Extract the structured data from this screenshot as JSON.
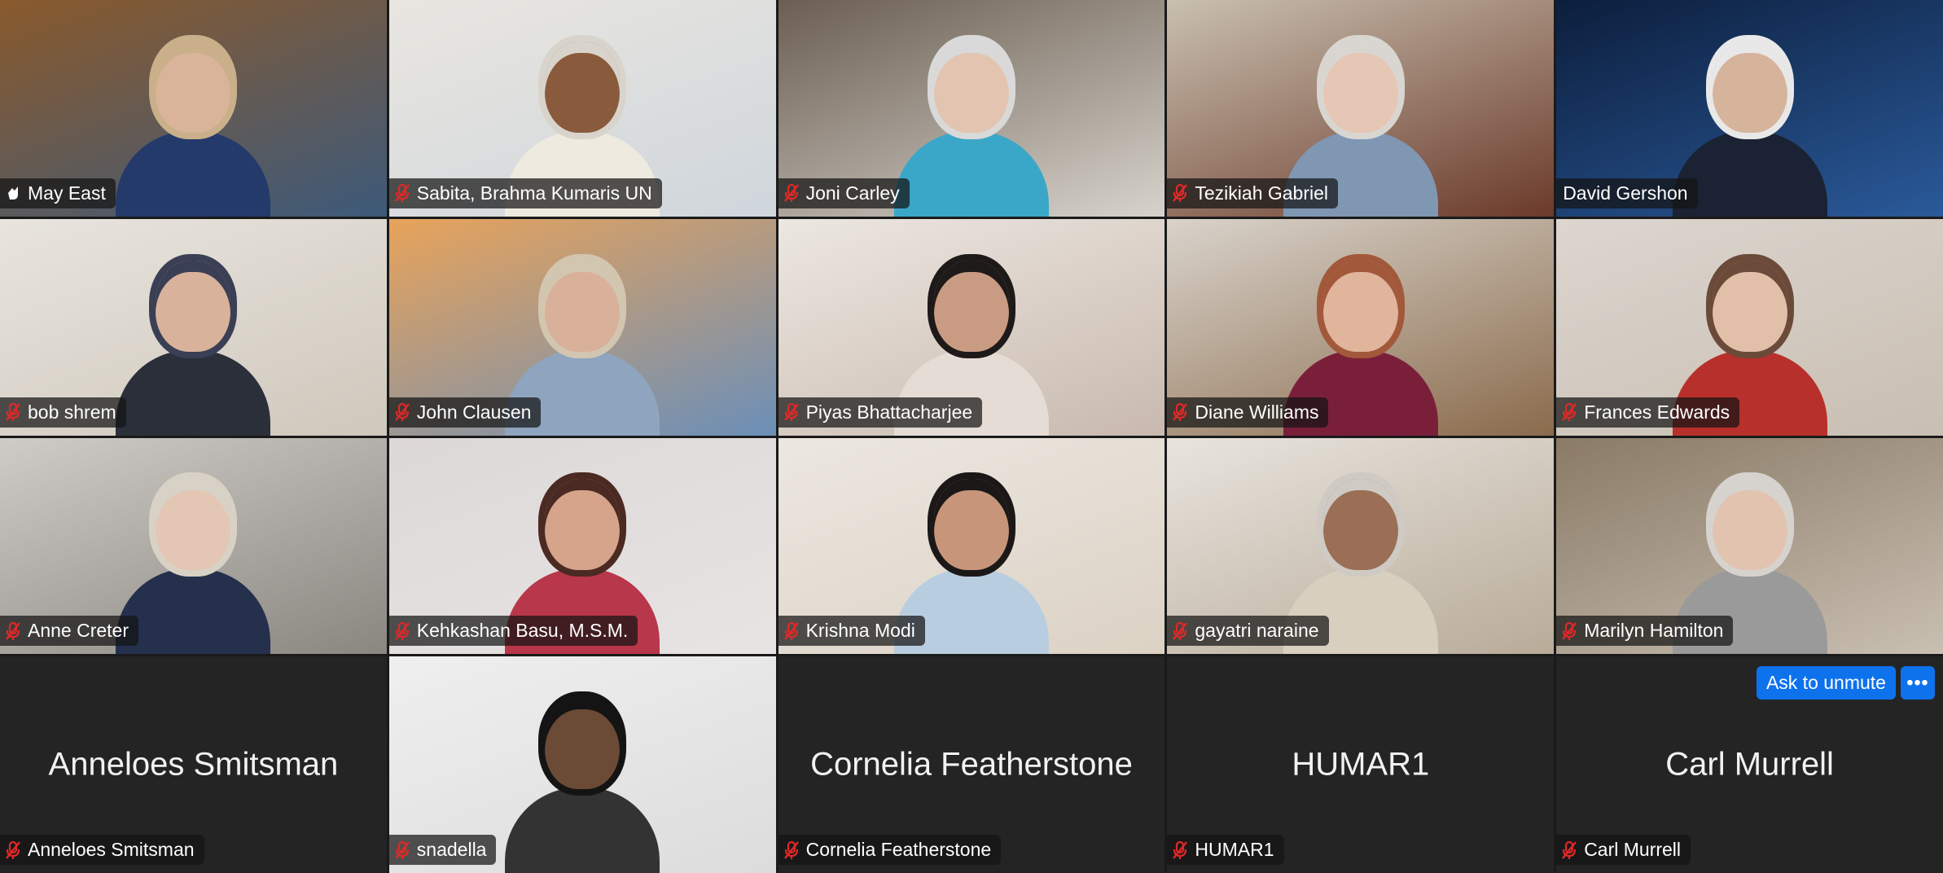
{
  "participants": [
    {
      "name": "May East",
      "mic": "hand",
      "speaking": true,
      "bg": "#8a5a2c",
      "bg2": "#3d5a7a",
      "skin": "#d9b39a",
      "hair": "#c9b08a",
      "shirt": "#243a6b"
    },
    {
      "name": "Sabita, Brahma Kumaris UN",
      "mic": "muted",
      "bg": "#e9e6e0",
      "bg2": "#cfd6dc",
      "skin": "#8a5a3c",
      "hair": "#d8d4cc",
      "shirt": "#efeae0"
    },
    {
      "name": "Joni Carley",
      "mic": "muted",
      "bg": "#6b5e52",
      "bg2": "#d7d3cc",
      "skin": "#e2c4b0",
      "hair": "#d9d9d9",
      "shirt": "#3aa7c9"
    },
    {
      "name": "Tezikiah Gabriel",
      "mic": "muted",
      "bg": "#c9c0b0",
      "bg2": "#6b3a2a",
      "skin": "#e6c6b4",
      "hair": "#d9d6d2",
      "shirt": "#7f97b3"
    },
    {
      "name": "David Gershon",
      "mic": "none",
      "bg": "#0c1e3c",
      "bg2": "#2a5a9a",
      "skin": "#d6b49c",
      "hair": "#e8e8e8",
      "shirt": "#1a2233"
    },
    {
      "name": "bob shrem",
      "mic": "muted",
      "bg": "#e8e4de",
      "bg2": "#cfc8bc",
      "skin": "#d8b29a",
      "hair": "#3b3f55",
      "shirt": "#2a2f3a"
    },
    {
      "name": "John Clausen",
      "mic": "muted",
      "bg": "#e8a35a",
      "bg2": "#6b8fb8",
      "skin": "#d9b09a",
      "hair": "#d2c6b0",
      "shirt": "#8fa4bf"
    },
    {
      "name": "Piyas Bhattacharjee",
      "mic": "muted",
      "bg": "#ece7e1",
      "bg2": "#c9b9ae",
      "skin": "#c99b82",
      "hair": "#1e1a1a",
      "shirt": "#e4dcd5"
    },
    {
      "name": "Diane Williams",
      "mic": "muted",
      "bg": "#d9d3cb",
      "bg2": "#8a6b4c",
      "skin": "#e0b59c",
      "hair": "#a2583a",
      "shirt": "#7a1f3a"
    },
    {
      "name": "Frances Edwards",
      "mic": "muted",
      "bg": "#dcd6cf",
      "bg2": "#c9beb2",
      "skin": "#e2bfa8",
      "hair": "#6b4a3a",
      "shirt": "#b8302c"
    },
    {
      "name": "Anne Creter",
      "mic": "muted",
      "bg": "#cfcbc6",
      "bg2": "#8a8680",
      "skin": "#e4c6b4",
      "hair": "#d8d2c6",
      "shirt": "#25304d"
    },
    {
      "name": "Kehkashan Basu, M.S.M.",
      "mic": "muted",
      "bg": "#ddd8d8",
      "bg2": "#e8e4e4",
      "skin": "#d6a48a",
      "hair": "#4a2a22",
      "shirt": "#b8374a"
    },
    {
      "name": "Krishna Modi",
      "mic": "muted",
      "bg": "#ece7e1",
      "bg2": "#dcd2c4",
      "skin": "#c7967a",
      "hair": "#1c1818",
      "shirt": "#b9cde0"
    },
    {
      "name": "gayatri naraine",
      "mic": "muted",
      "bg": "#e8e4de",
      "bg2": "#b8ab98",
      "skin": "#9a6f56",
      "hair": "#cfcac3",
      "shirt": "#d9cfbf"
    },
    {
      "name": "Marilyn Hamilton",
      "mic": "muted",
      "bg": "#8a7a66",
      "bg2": "#c9bfb2",
      "skin": "#e2c3b0",
      "hair": "#d6d3cf",
      "shirt": "#9a9a9a"
    },
    {
      "name": "Anneloes Smitsman",
      "mic": "muted",
      "video": false
    },
    {
      "name": "snadella",
      "mic": "muted",
      "bg": "#efefef",
      "bg2": "#dcdcdc",
      "skin": "#6b4a36",
      "hair": "#141414",
      "shirt": "#333333"
    },
    {
      "name": "Cornelia Featherstone",
      "mic": "muted",
      "video": false
    },
    {
      "name": "HUMAR1",
      "mic": "muted",
      "video": false
    },
    {
      "name": "Carl Murrell",
      "mic": "muted",
      "video": false,
      "ask_to_unmute": true
    }
  ],
  "controls": {
    "ask_to_unmute_label": "Ask to unmute",
    "more_label": "•••"
  },
  "colors": {
    "speaking_border": "#3ccf4e",
    "mute_icon": "#e02828",
    "accent_blue": "#0e72ed"
  }
}
